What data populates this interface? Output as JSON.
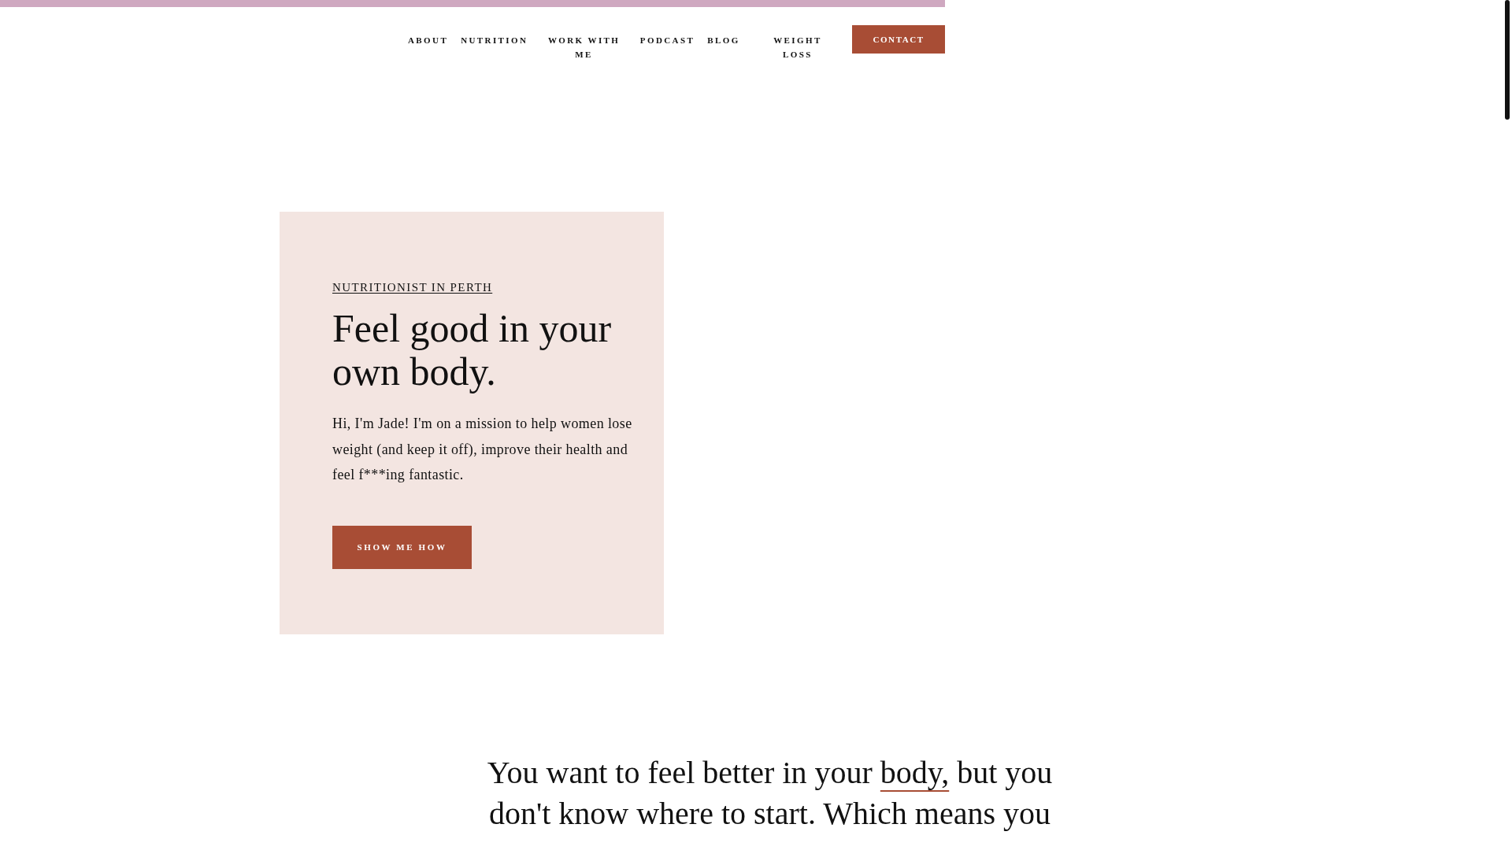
{
  "nav": {
    "links": [
      {
        "label": "ABOUT"
      },
      {
        "label": "NUTRITION"
      },
      {
        "label": "WORK WITH ME"
      },
      {
        "label": "PODCAST"
      },
      {
        "label": "BLOG"
      },
      {
        "label": "WEIGHT LOSS"
      }
    ],
    "cta": "CONTACT"
  },
  "hero": {
    "eyebrow": "NUTRITIONIST IN PERTH",
    "heading": "Feel good in your own body.",
    "body": "Hi, I'm Jade! I'm on a mission to help women lose weight (and keep it off), improve their health and feel f***ing fantastic.",
    "button": "SHOW ME HOW"
  },
  "intro": {
    "before": "You want to feel better in your ",
    "underlined": "body,",
    "after": " but you don't know where to start. Which means you"
  }
}
